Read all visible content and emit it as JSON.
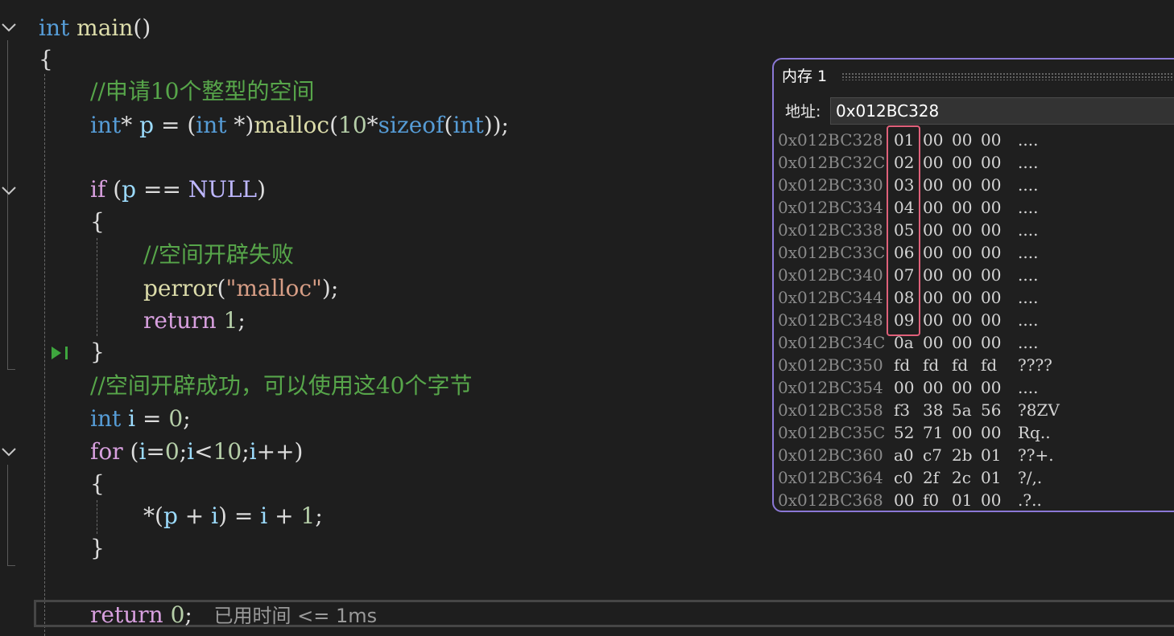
{
  "code": {
    "line1": {
      "kw": "int",
      "fn": "main",
      "punc": "()"
    },
    "brace_open_main": "{",
    "comment1": "//申请10个整型的空间",
    "line_malloc": {
      "kw1": "int",
      "p1": "* ",
      "var1": "p",
      "p2": " = (",
      "kw2": "int",
      "p3": " *)",
      "fn": "malloc",
      "p4": "(",
      "num": "10",
      "p5": "*",
      "kw3": "sizeof",
      "p6": "(",
      "kw4": "int",
      "p7": "));"
    },
    "line_if": {
      "kw": "if",
      "p1": " (",
      "var": "p",
      "p2": " == ",
      "mac": "NULL",
      "p3": ")"
    },
    "brace_open_if": "{",
    "comment2": "//空间开辟失败",
    "line_perror": {
      "fn": "perror",
      "p1": "(",
      "str": "\"malloc\"",
      "p2": ");"
    },
    "line_return1": {
      "kw": "return",
      "num": "1",
      "p": ";"
    },
    "brace_close_if": "}",
    "comment3": "//空间开辟成功，可以使用这40个字节",
    "line_int_i": {
      "kw": "int",
      "var": "i",
      "p1": " = ",
      "num": "0",
      "p2": ";"
    },
    "line_for": {
      "kw": "for",
      "p1": " (",
      "v1": "i",
      "p2": "=",
      "n1": "0",
      "p3": ";",
      "v2": "i",
      "p4": "<",
      "n2": "10",
      "p5": ";",
      "v3": "i",
      "p6": "++)"
    },
    "brace_open_for": "{",
    "line_assign": {
      "p1": "*(",
      "v1": "p",
      "p2": " + ",
      "v2": "i",
      "p3": ") = ",
      "v3": "i",
      "p4": " + ",
      "n": "1",
      "p5": ";"
    },
    "brace_close_for": "}",
    "line_return0": {
      "kw": "return",
      "num": "0",
      "p": ";"
    },
    "elapsed": "已用时间 <= 1ms"
  },
  "memory_window": {
    "title": "内存 1",
    "address_label": "地址:",
    "address_value": "0x012BC328",
    "rows": [
      {
        "addr": "0x012BC328",
        "bytes": [
          "01",
          "00",
          "00",
          "00"
        ],
        "ascii": "...."
      },
      {
        "addr": "0x012BC32C",
        "bytes": [
          "02",
          "00",
          "00",
          "00"
        ],
        "ascii": "...."
      },
      {
        "addr": "0x012BC330",
        "bytes": [
          "03",
          "00",
          "00",
          "00"
        ],
        "ascii": "...."
      },
      {
        "addr": "0x012BC334",
        "bytes": [
          "04",
          "00",
          "00",
          "00"
        ],
        "ascii": "...."
      },
      {
        "addr": "0x012BC338",
        "bytes": [
          "05",
          "00",
          "00",
          "00"
        ],
        "ascii": "...."
      },
      {
        "addr": "0x012BC33C",
        "bytes": [
          "06",
          "00",
          "00",
          "00"
        ],
        "ascii": "...."
      },
      {
        "addr": "0x012BC340",
        "bytes": [
          "07",
          "00",
          "00",
          "00"
        ],
        "ascii": "...."
      },
      {
        "addr": "0x012BC344",
        "bytes": [
          "08",
          "00",
          "00",
          "00"
        ],
        "ascii": "...."
      },
      {
        "addr": "0x012BC348",
        "bytes": [
          "09",
          "00",
          "00",
          "00"
        ],
        "ascii": "...."
      },
      {
        "addr": "0x012BC34C",
        "bytes": [
          "0a",
          "00",
          "00",
          "00"
        ],
        "ascii": "...."
      },
      {
        "addr": "0x012BC350",
        "bytes": [
          "fd",
          "fd",
          "fd",
          "fd"
        ],
        "ascii": "????"
      },
      {
        "addr": "0x012BC354",
        "bytes": [
          "00",
          "00",
          "00",
          "00"
        ],
        "ascii": "...."
      },
      {
        "addr": "0x012BC358",
        "bytes": [
          "f3",
          "38",
          "5a",
          "56"
        ],
        "ascii": "?8ZV"
      },
      {
        "addr": "0x012BC35C",
        "bytes": [
          "52",
          "71",
          "00",
          "00"
        ],
        "ascii": "Rq.."
      },
      {
        "addr": "0x012BC360",
        "bytes": [
          "a0",
          "c7",
          "2b",
          "01"
        ],
        "ascii": "??+."
      },
      {
        "addr": "0x012BC364",
        "bytes": [
          "c0",
          "2f",
          "2c",
          "01"
        ],
        "ascii": "?/,."
      },
      {
        "addr": "0x012BC368",
        "bytes": [
          "00",
          "f0",
          "01",
          "00"
        ],
        "ascii": ".?.."
      }
    ]
  },
  "colors": {
    "background": "#1e1e1e",
    "keyword": "#569cd6",
    "control_keyword": "#d8a0df",
    "function": "#dcdcaa",
    "comment": "#57a64a",
    "highlight_box": "#e0607a",
    "memory_window_border": "#8b78d6"
  }
}
